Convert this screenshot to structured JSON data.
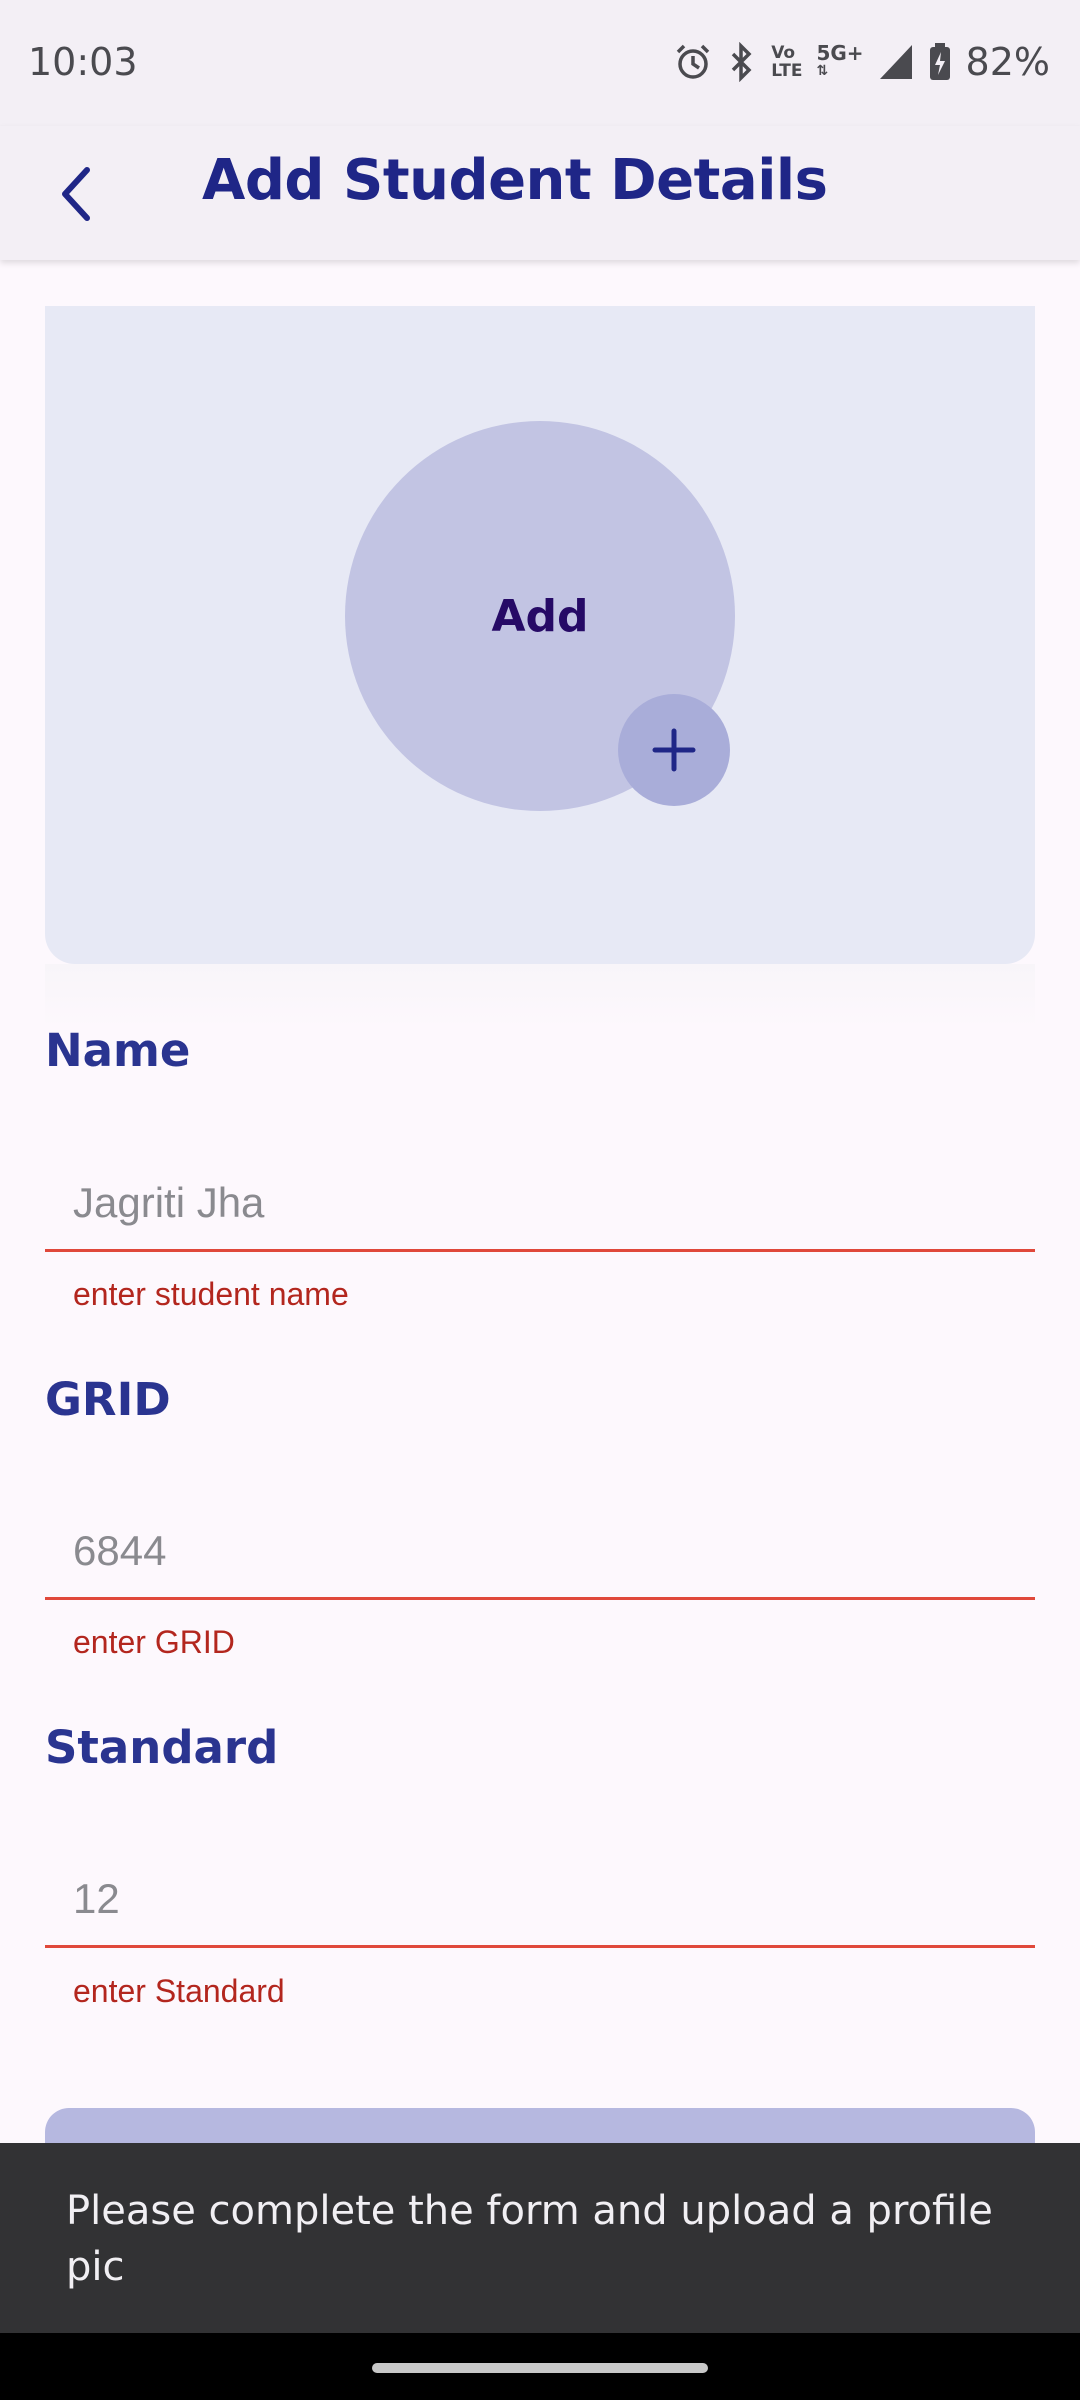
{
  "status_bar": {
    "time": "10:03",
    "battery": "82%",
    "network_top": "Vo",
    "network_bottom": "LTE",
    "signal_label": "5G+"
  },
  "app_bar": {
    "title": "Add Student Details",
    "back_icon": "back-arrow-icon"
  },
  "photo": {
    "avatar_label": "Add",
    "add_icon": "plus-icon"
  },
  "form": {
    "name": {
      "label": "Name",
      "placeholder": "Jagriti Jha",
      "error": "enter student name"
    },
    "grid": {
      "label": "GRID",
      "placeholder": "6844",
      "error": "enter GRID"
    },
    "standard": {
      "label": "Standard",
      "placeholder": "12",
      "error": "enter Standard"
    }
  },
  "snackbar": {
    "message": "Please complete the form and upload a profile pic"
  },
  "colors": {
    "accent": "#1f2687",
    "error": "#b3261e",
    "underline_error": "#e0483b",
    "card_bg": "#e7e9f5",
    "avatar_bg": "#c2c4e3"
  }
}
